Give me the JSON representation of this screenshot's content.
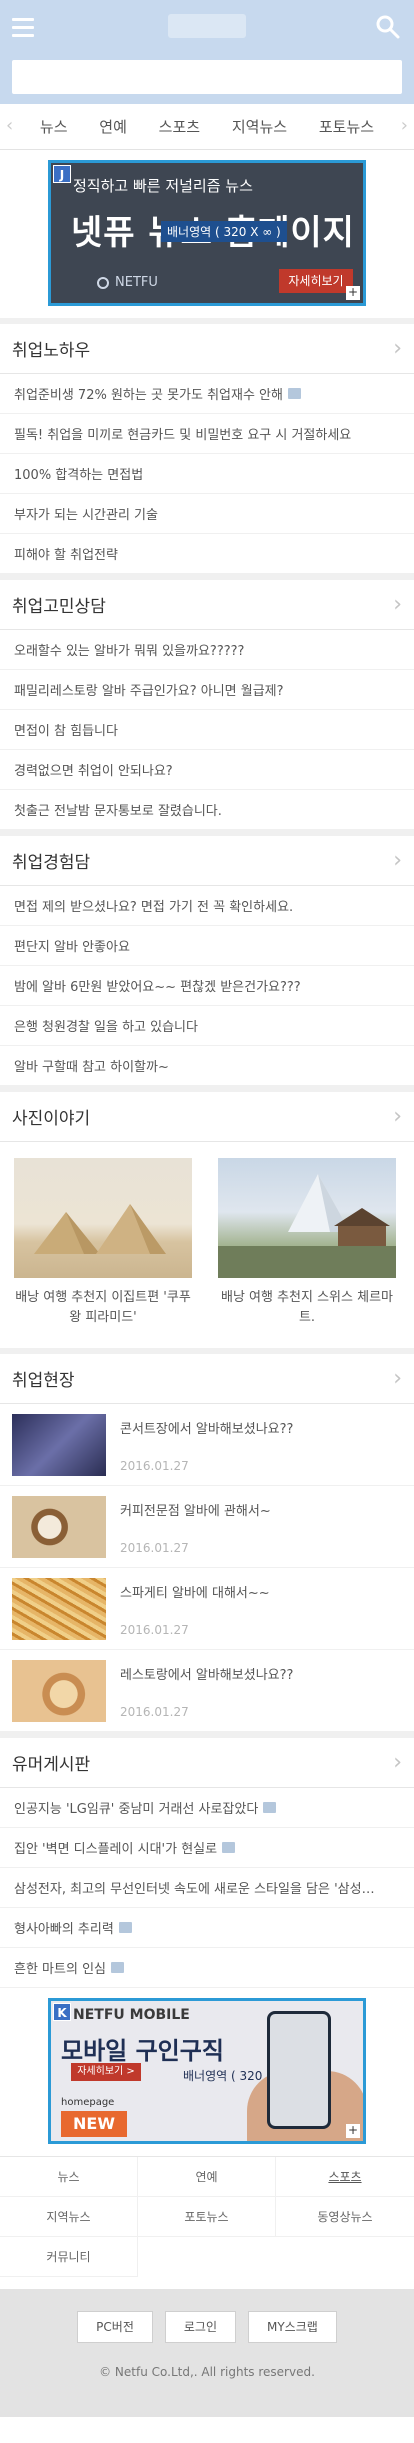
{
  "header": {
    "menu_icon": "hamburger-icon",
    "search_icon": "search-icon",
    "colors": {
      "header_bg": "#c7d9ee",
      "accent": "#2b9ad6"
    }
  },
  "search": {
    "placeholder": ""
  },
  "tabs": {
    "items": [
      "뉴스",
      "연예",
      "스포츠",
      "지역뉴스",
      "포토뉴스"
    ]
  },
  "ad_top": {
    "letter": "J",
    "kicker": "정직하고 빠른 저널리즘 뉴스",
    "headline": "넷퓨 뉴스 홈페이지",
    "slot": "배너영역 ( 320 X ∞ )",
    "brand": "NETFU",
    "cta": "자세히보기",
    "expand": "+"
  },
  "sections": {
    "know_how": {
      "title": "취업노하우",
      "posts": [
        {
          "text": "취업준비생 72% 원하는 곳 못가도 취업재수 안해",
          "has_image": true
        },
        {
          "text": "필독! 취업을 미끼로 현금카드 및 비밀번호 요구 시 거절하세요",
          "has_image": false
        },
        {
          "text": "100% 합격하는 면접법",
          "has_image": false
        },
        {
          "text": "부자가 되는 시간관리 기술",
          "has_image": false
        },
        {
          "text": "피해야 할 취업전략",
          "has_image": false
        }
      ]
    },
    "counsel": {
      "title": "취업고민상담",
      "posts": [
        {
          "text": "오래할수 있는 알바가 뭐뭐 있을까요?????",
          "has_image": false
        },
        {
          "text": "패밀리레스토랑 알바 주급인가요? 아니면 월급제?",
          "has_image": false
        },
        {
          "text": "면접이 참 힘듭니다",
          "has_image": false
        },
        {
          "text": "경력없으면 취업이 안되나요?",
          "has_image": false
        },
        {
          "text": "첫출근 전날밤 문자통보로 잘렸습니다.",
          "has_image": false
        }
      ]
    },
    "experience": {
      "title": "취업경험담",
      "posts": [
        {
          "text": "면접 제의 받으셨나요? 면접 가기 전 꼭 확인하세요.",
          "has_image": false
        },
        {
          "text": "편단지 알바 안좋아요",
          "has_image": false
        },
        {
          "text": "밤에 알바 6만원 받았어요~~ 편찮겠 받은건가요???",
          "has_image": false
        },
        {
          "text": "은행 청원경찰 일을 하고 있습니다",
          "has_image": false
        },
        {
          "text": "알바 구할때 참고 하이할까~",
          "has_image": false
        }
      ]
    },
    "photo": {
      "title": "사진이야기",
      "items": [
        {
          "caption": "배낭 여행 추천지 이집트편 '쿠푸왕 피라미드'",
          "image": "pyramid-photo"
        },
        {
          "caption": "배낭 여행 추천지 스위스 체르마트.",
          "image": "matterhorn-photo"
        }
      ]
    },
    "scene": {
      "title": "취업현장",
      "items": [
        {
          "title": "콘서트장에서 알바해보셨나요??",
          "date": "2016.01.27",
          "color": "#4a4d78"
        },
        {
          "title": "커피전문점 알바에 관해서~",
          "date": "2016.01.27",
          "color": "#b8935d"
        },
        {
          "title": "스파게티 알바에 대해서~~",
          "date": "2016.01.27",
          "color": "#d69a4a"
        },
        {
          "title": "레스토랑에서 알바해보셨나요??",
          "date": "2016.01.27",
          "color": "#d9a06b"
        }
      ]
    },
    "humor": {
      "title": "유머게시판",
      "posts": [
        {
          "text": "인공지능 'LG임큐' 중남미 거래선 사로잡았다",
          "has_image": true
        },
        {
          "text": "집안 '벽면 디스플레이 시대'가 현실로",
          "has_image": true
        },
        {
          "text": "삼성전자, 최고의 무선인터넷 속도에 새로운 스타일을 담은 '삼성…",
          "has_image": false
        },
        {
          "text": "형사아빠의 추리력",
          "has_image": true
        },
        {
          "text": "흔한 마트의 인심",
          "has_image": true
        }
      ]
    }
  },
  "ad_bottom": {
    "letter": "K",
    "kicker": "NETFU MOBILE",
    "headline": "모바일 구인구직",
    "slot": "배너영역 ( 320 X ∞ )",
    "cta": "자세히보기 >",
    "home": "homepage",
    "new": "NEW",
    "expand": "+"
  },
  "footer": {
    "links": [
      "뉴스",
      "연예",
      "스포츠",
      "지역뉴스",
      "포토뉴스",
      "동영상뉴스",
      "커뮤니티"
    ],
    "active_link": "스포츠",
    "buttons": [
      "PC버전",
      "로그인",
      "MY스크랩"
    ],
    "copyright": "© Netfu Co.Ltd,. All rights reserved."
  }
}
